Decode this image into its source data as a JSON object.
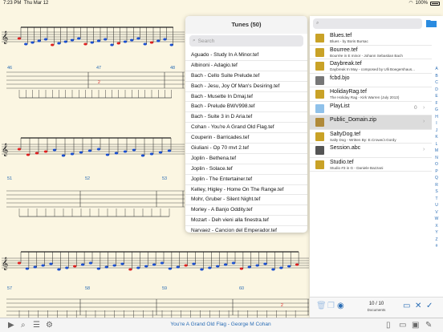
{
  "status": {
    "time": "7:23 PM",
    "date": "Thu Mar 12",
    "battery": "100%"
  },
  "score": {
    "bar_numbers": [
      "46",
      "47",
      "48",
      "51",
      "52",
      "53",
      "57",
      "58",
      "59",
      "60"
    ]
  },
  "tunes": {
    "title": "Tunes (50)",
    "search_placeholder": "Search",
    "items": [
      "Aguado - Study In A Minor.tef",
      "Albinoni - Adagio.tef",
      "Bach - Cello Suite Prelude.tef",
      "Bach - Jesu, Joy Of Man's Desiring.tef",
      "Bach - Musette In Dmaj.tef",
      "Bach - Prelude BWV998.tef",
      "Bach - Suite 3 in D Aria.tef",
      "Cohan - You're A Grand Old Flag.tef",
      "Couperin - Barricades.tef",
      "Giuliani - Op 70 mvt 2.tef",
      "Joplin - Bethena.tef",
      "Joplin - Solace.tef",
      "Joplin - The Entertainer.tef",
      "Kelley, Higley - Home On The Range.tef",
      "Mohr, Gruber - Silent Night.tef",
      "Morley - A Banjo Oddity.tef",
      "Mozart - Deh vieni alla finestra.tef",
      "Narvaez - Cancion del Emperador.tef"
    ]
  },
  "files": {
    "items": [
      {
        "name": "Blues.tef",
        "sub": "Blues - by Boris Bursac",
        "icon": "tef-file-icon",
        "badge": "",
        "chevron": false,
        "selected": false
      },
      {
        "name": "Bourree.tef",
        "sub": "Bourrée in E minor - Johann Sebastian Bach",
        "icon": "tef-file-icon",
        "badge": "",
        "chevron": false,
        "selected": false
      },
      {
        "name": "Daybreak.tef",
        "sub": "Daybreak In May - composed by Ulli Boegershaus...",
        "icon": "tef-file-icon",
        "badge": "",
        "chevron": false,
        "selected": false
      },
      {
        "name": "fcbd.bjo",
        "sub": "",
        "icon": "bjo-file-icon",
        "badge": "",
        "chevron": false,
        "selected": false
      },
      {
        "name": "HolidayRag.tef",
        "sub": "The Holiday Rag - Kirk Warren (July 2013)",
        "icon": "tef-file-icon",
        "badge": "",
        "chevron": false,
        "selected": false
      },
      {
        "name": "PlayList",
        "sub": "",
        "icon": "folder-icon",
        "badge": "0",
        "chevron": true,
        "selected": false
      },
      {
        "name": "Public_Domain.zip",
        "sub": "",
        "icon": "zip-file-icon",
        "badge": "",
        "chevron": true,
        "selected": true
      },
      {
        "name": "SaltyDog.tef",
        "sub": "Salty Dog -    Written By: E.Crowe/J.Gordy",
        "icon": "tef-file-icon",
        "badge": "",
        "chevron": false,
        "selected": false
      },
      {
        "name": "Session.abc",
        "sub": "",
        "icon": "abc-file-icon",
        "badge": "",
        "chevron": true,
        "selected": false
      },
      {
        "name": "Studio.tef",
        "sub": "Studio #3 in G - Daniele Bazzani",
        "icon": "tef-file-icon",
        "badge": "",
        "chevron": false,
        "selected": false
      }
    ],
    "alphabet": [
      "A",
      "B",
      "C",
      "D",
      "E",
      "F",
      "G",
      "H",
      "I",
      "J",
      "K",
      "L",
      "M",
      "N",
      "O",
      "P",
      "Q",
      "R",
      "S",
      "T",
      "U",
      "V",
      "W",
      "X",
      "Y",
      "Z",
      "#"
    ],
    "doc_count": "10 / 10",
    "doc_label": "Documents"
  },
  "toolbar": {
    "title": "You're A Grand Old Flag - George M Cohan"
  },
  "colors": {
    "accent": "#2a6db5",
    "note_red": "#e02020",
    "note_blue": "#1a4fd1",
    "paper": "#fbf6e2"
  }
}
